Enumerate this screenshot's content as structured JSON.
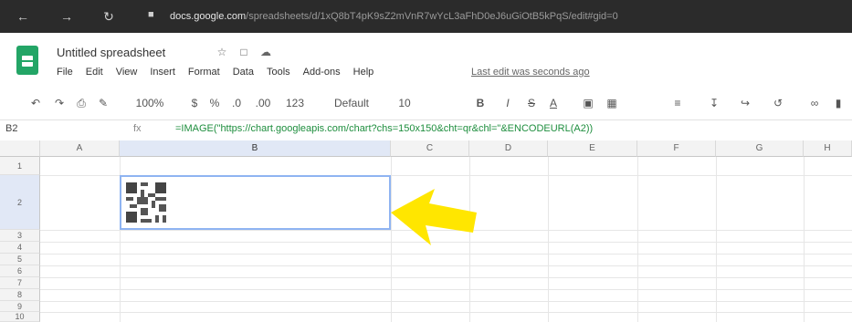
{
  "browser": {
    "url_host": "docs.google.com",
    "url_rest": "/spreadsheets/d/1xQ8bT4pK9sZ2mVnR7wYcL3aFhD0eJ6uGiOtB5kPqS/edit#gid=0"
  },
  "doc": {
    "title": "Untitled spreadsheet",
    "menu": [
      "File",
      "Edit",
      "View",
      "Insert",
      "Format",
      "Data",
      "Tools",
      "Add-ons",
      "Help"
    ],
    "last_edit": "Last edit was seconds ago"
  },
  "toolbar": {
    "zoom": "100%",
    "currency": "$",
    "percent": "%",
    "decimals_less": ".0",
    "decimals_more": ".00",
    "number_format": "123",
    "font": "Default",
    "font_size": "10",
    "bold": "B",
    "italic": "I",
    "strike": "S",
    "text_color": "A"
  },
  "formula_bar": {
    "cell_ref": "B2",
    "fx": "fx",
    "formula": "=IMAGE(\"https://chart.googleapis.com/chart?chs=150x150&cht=qr&chl=\"&ENCODEURL(A2))"
  },
  "grid": {
    "columns": [
      "A",
      "B",
      "C",
      "D",
      "E",
      "F",
      "G",
      "H"
    ],
    "rows": [
      "1",
      "2",
      "3",
      "4",
      "5",
      "6",
      "7",
      "8",
      "9",
      "10"
    ],
    "selected_column": "B",
    "selected_row": "2"
  },
  "annotation": {
    "arrow_color": "#ffe600"
  }
}
